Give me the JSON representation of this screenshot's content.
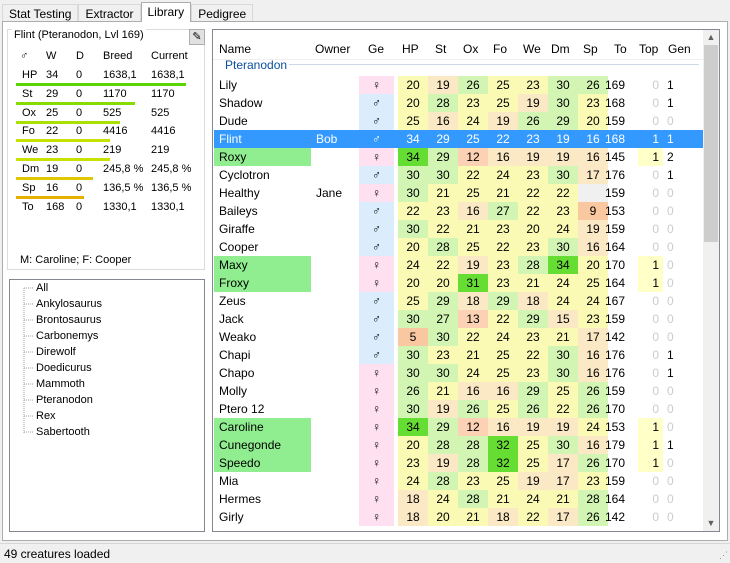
{
  "tabs": [
    "Stat Testing",
    "Extractor",
    "Library",
    "Pedigree"
  ],
  "info": {
    "title": "Flint (Pteranodon, Lvl 169)",
    "headers": [
      "♂",
      "W",
      "D",
      "Breed",
      "Current"
    ],
    "stats": [
      {
        "label": "HP",
        "w": "34",
        "d": "0",
        "breed": "1638,1",
        "current": "1638,1",
        "bar": 1.0,
        "color": "#5ad600"
      },
      {
        "label": "St",
        "w": "29",
        "d": "0",
        "breed": "1170",
        "current": "1170",
        "bar": 0.7,
        "color": "#84dc00"
      },
      {
        "label": "Ox",
        "w": "25",
        "d": "0",
        "breed": "525",
        "current": "525",
        "bar": 0.61,
        "color": "#a9e000"
      },
      {
        "label": "Fo",
        "w": "22",
        "d": "0",
        "breed": "4416",
        "current": "4416",
        "bar": 0.55,
        "color": "#c8e200"
      },
      {
        "label": "We",
        "w": "23",
        "d": "0",
        "breed": "219",
        "current": "219",
        "bar": 0.55,
        "color": "#c8e200"
      },
      {
        "label": "Dm",
        "w": "19",
        "d": "0",
        "breed": "245,8 %",
        "current": "245,8 %",
        "bar": 0.45,
        "color": "#e0c800"
      },
      {
        "label": "Sp",
        "w": "16",
        "d": "0",
        "breed": "136,5 %",
        "current": "136,5 %",
        "bar": 0.4,
        "color": "#e6b000"
      },
      {
        "label": "To",
        "w": "168",
        "d": "0",
        "breed": "1330,1",
        "current": "1330,1"
      }
    ],
    "parents": "M: Caroline; F: Cooper"
  },
  "species": [
    "All",
    "Ankylosaurus",
    "Brontosaurus",
    "Carbonemys",
    "Direwolf",
    "Doedicurus",
    "Mammoth",
    "Pteranodon",
    "Rex",
    "Sabertooth"
  ],
  "columns": [
    "Name",
    "Owner",
    "Ge",
    "HP",
    "St",
    "Ox",
    "Fo",
    "We",
    "Dm",
    "Sp",
    "To",
    "Top",
    "Gen"
  ],
  "group": "Pteranodon",
  "rows": [
    {
      "name": "Lily",
      "owner": "",
      "sex": "♀",
      "s": [
        "20",
        "19",
        "26",
        "25",
        "23",
        "30",
        "26"
      ],
      "to": "169",
      "top": "0",
      "gen": "1"
    },
    {
      "name": "Shadow",
      "owner": "",
      "sex": "♂",
      "s": [
        "20",
        "28",
        "23",
        "25",
        "19",
        "30",
        "23"
      ],
      "to": "168",
      "top": "0",
      "gen": "1"
    },
    {
      "name": "Dude",
      "owner": "",
      "sex": "♂",
      "s": [
        "25",
        "16",
        "24",
        "19",
        "26",
        "29",
        "20"
      ],
      "to": "159",
      "top": "0",
      "gen": "0"
    },
    {
      "name": "Flint",
      "owner": "Bob",
      "sex": "♂",
      "s": [
        "34",
        "29",
        "25",
        "22",
        "23",
        "19",
        "16"
      ],
      "to": "168",
      "top": "1",
      "gen": "1",
      "sel": true
    },
    {
      "name": "Roxy",
      "owner": "",
      "sex": "♀",
      "s": [
        "34",
        "29",
        "12",
        "16",
        "19",
        "19",
        "16"
      ],
      "to": "145",
      "top": "1",
      "gen": "2",
      "hl": true
    },
    {
      "name": "Cyclotron",
      "owner": "",
      "sex": "♂",
      "s": [
        "30",
        "30",
        "22",
        "24",
        "23",
        "30",
        "17"
      ],
      "to": "176",
      "top": "0",
      "gen": "1"
    },
    {
      "name": "Healthy",
      "owner": "Jane",
      "sex": "♀",
      "s": [
        "30",
        "21",
        "25",
        "21",
        "22",
        "22",
        ""
      ],
      "to": "159",
      "top": "0",
      "gen": "0"
    },
    {
      "name": "Baileys",
      "owner": "",
      "sex": "♂",
      "s": [
        "22",
        "23",
        "16",
        "27",
        "22",
        "23",
        "9"
      ],
      "to": "153",
      "top": "0",
      "gen": "0"
    },
    {
      "name": "Giraffe",
      "owner": "",
      "sex": "♂",
      "s": [
        "30",
        "22",
        "21",
        "23",
        "20",
        "24",
        "19"
      ],
      "to": "159",
      "top": "0",
      "gen": "0"
    },
    {
      "name": "Cooper",
      "owner": "",
      "sex": "♂",
      "s": [
        "20",
        "28",
        "25",
        "22",
        "23",
        "30",
        "16"
      ],
      "to": "164",
      "top": "0",
      "gen": "0"
    },
    {
      "name": "Maxy",
      "owner": "",
      "sex": "♀",
      "s": [
        "24",
        "22",
        "19",
        "23",
        "28",
        "34",
        "20"
      ],
      "to": "170",
      "top": "1",
      "gen": "0",
      "hl": true
    },
    {
      "name": "Froxy",
      "owner": "",
      "sex": "♀",
      "s": [
        "20",
        "20",
        "31",
        "23",
        "21",
        "24",
        "25"
      ],
      "to": "164",
      "top": "1",
      "gen": "0",
      "hl": true
    },
    {
      "name": "Zeus",
      "owner": "",
      "sex": "♂",
      "s": [
        "25",
        "29",
        "18",
        "29",
        "18",
        "24",
        "24"
      ],
      "to": "167",
      "top": "0",
      "gen": "0"
    },
    {
      "name": "Jack",
      "owner": "",
      "sex": "♂",
      "s": [
        "30",
        "27",
        "13",
        "22",
        "29",
        "15",
        "23"
      ],
      "to": "159",
      "top": "0",
      "gen": "0"
    },
    {
      "name": "Weako",
      "owner": "",
      "sex": "♂",
      "s": [
        "5",
        "30",
        "22",
        "24",
        "23",
        "21",
        "17"
      ],
      "to": "142",
      "top": "0",
      "gen": "0"
    },
    {
      "name": "Chapi",
      "owner": "",
      "sex": "♂",
      "s": [
        "30",
        "23",
        "21",
        "25",
        "22",
        "30",
        "16"
      ],
      "to": "176",
      "top": "0",
      "gen": "1"
    },
    {
      "name": "Chapo",
      "owner": "",
      "sex": "♀",
      "s": [
        "30",
        "30",
        "24",
        "25",
        "23",
        "30",
        "16"
      ],
      "to": "176",
      "top": "0",
      "gen": "1"
    },
    {
      "name": "Molly",
      "owner": "",
      "sex": "♀",
      "s": [
        "26",
        "21",
        "16",
        "16",
        "29",
        "25",
        "26"
      ],
      "to": "159",
      "top": "0",
      "gen": "0"
    },
    {
      "name": "Ptero 12",
      "owner": "",
      "sex": "♀",
      "s": [
        "30",
        "19",
        "26",
        "25",
        "26",
        "22",
        "26"
      ],
      "to": "170",
      "top": "0",
      "gen": "0"
    },
    {
      "name": "Caroline",
      "owner": "",
      "sex": "♀",
      "s": [
        "34",
        "29",
        "12",
        "16",
        "19",
        "19",
        "24"
      ],
      "to": "153",
      "top": "1",
      "gen": "0",
      "hl": true
    },
    {
      "name": "Cunegonde",
      "owner": "",
      "sex": "♀",
      "s": [
        "20",
        "28",
        "28",
        "32",
        "25",
        "30",
        "16"
      ],
      "to": "179",
      "top": "1",
      "gen": "1",
      "hl": true
    },
    {
      "name": "Speedo",
      "owner": "",
      "sex": "♀",
      "s": [
        "23",
        "19",
        "28",
        "32",
        "25",
        "17",
        "26"
      ],
      "to": "170",
      "top": "1",
      "gen": "0",
      "hl": true
    },
    {
      "name": "Mia",
      "owner": "",
      "sex": "♀",
      "s": [
        "24",
        "28",
        "23",
        "25",
        "19",
        "17",
        "23"
      ],
      "to": "159",
      "top": "0",
      "gen": "0"
    },
    {
      "name": "Hermes",
      "owner": "",
      "sex": "♀",
      "s": [
        "18",
        "24",
        "28",
        "21",
        "24",
        "21",
        "28"
      ],
      "to": "164",
      "top": "0",
      "gen": "0"
    },
    {
      "name": "Girly",
      "owner": "",
      "sex": "♀",
      "s": [
        "18",
        "20",
        "21",
        "18",
        "22",
        "17",
        "26"
      ],
      "to": "142",
      "top": "0",
      "gen": "0"
    }
  ],
  "status": "49 creatures loaded",
  "colors": {
    "selection": "#3399ff",
    "highlight": "#90ee90",
    "female": "#ffe0f0",
    "male": "#dbecfc",
    "top": "#ffffc8"
  }
}
